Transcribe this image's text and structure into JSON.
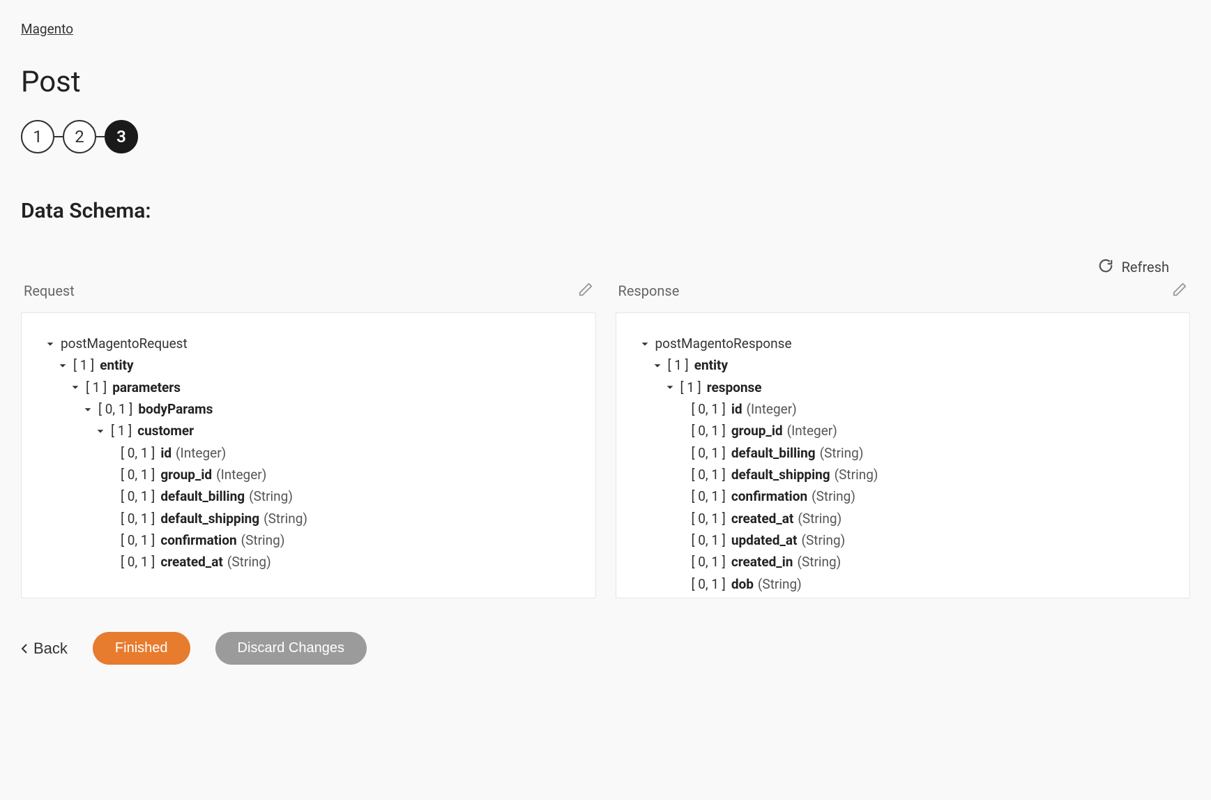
{
  "breadcrumb": {
    "link": "Magento"
  },
  "page": {
    "title": "Post"
  },
  "stepper": {
    "steps": [
      "1",
      "2",
      "3"
    ],
    "activeIndex": 2
  },
  "section": {
    "heading": "Data Schema:"
  },
  "refresh": {
    "label": "Refresh"
  },
  "request": {
    "title": "Request",
    "root": "postMagentoRequest",
    "entity": {
      "card": "[ 1 ]",
      "name": "entity"
    },
    "parameters": {
      "card": "[ 1 ]",
      "name": "parameters"
    },
    "bodyParams": {
      "card": "[ 0, 1 ]",
      "name": "bodyParams"
    },
    "customer": {
      "card": "[ 1 ]",
      "name": "customer"
    },
    "fields": [
      {
        "card": "[ 0, 1 ]",
        "name": "id",
        "type": "(Integer)"
      },
      {
        "card": "[ 0, 1 ]",
        "name": "group_id",
        "type": "(Integer)"
      },
      {
        "card": "[ 0, 1 ]",
        "name": "default_billing",
        "type": "(String)"
      },
      {
        "card": "[ 0, 1 ]",
        "name": "default_shipping",
        "type": "(String)"
      },
      {
        "card": "[ 0, 1 ]",
        "name": "confirmation",
        "type": "(String)"
      },
      {
        "card": "[ 0, 1 ]",
        "name": "created_at",
        "type": "(String)"
      }
    ]
  },
  "response": {
    "title": "Response",
    "root": "postMagentoResponse",
    "entity": {
      "card": "[ 1 ]",
      "name": "entity"
    },
    "responseNode": {
      "card": "[ 1 ]",
      "name": "response"
    },
    "fields": [
      {
        "card": "[ 0, 1 ]",
        "name": "id",
        "type": "(Integer)"
      },
      {
        "card": "[ 0, 1 ]",
        "name": "group_id",
        "type": "(Integer)"
      },
      {
        "card": "[ 0, 1 ]",
        "name": "default_billing",
        "type": "(String)"
      },
      {
        "card": "[ 0, 1 ]",
        "name": "default_shipping",
        "type": "(String)"
      },
      {
        "card": "[ 0, 1 ]",
        "name": "confirmation",
        "type": "(String)"
      },
      {
        "card": "[ 0, 1 ]",
        "name": "created_at",
        "type": "(String)"
      },
      {
        "card": "[ 0, 1 ]",
        "name": "updated_at",
        "type": "(String)"
      },
      {
        "card": "[ 0, 1 ]",
        "name": "created_in",
        "type": "(String)"
      },
      {
        "card": "[ 0, 1 ]",
        "name": "dob",
        "type": "(String)"
      }
    ]
  },
  "actions": {
    "back": "Back",
    "finished": "Finished",
    "discard": "Discard Changes"
  }
}
